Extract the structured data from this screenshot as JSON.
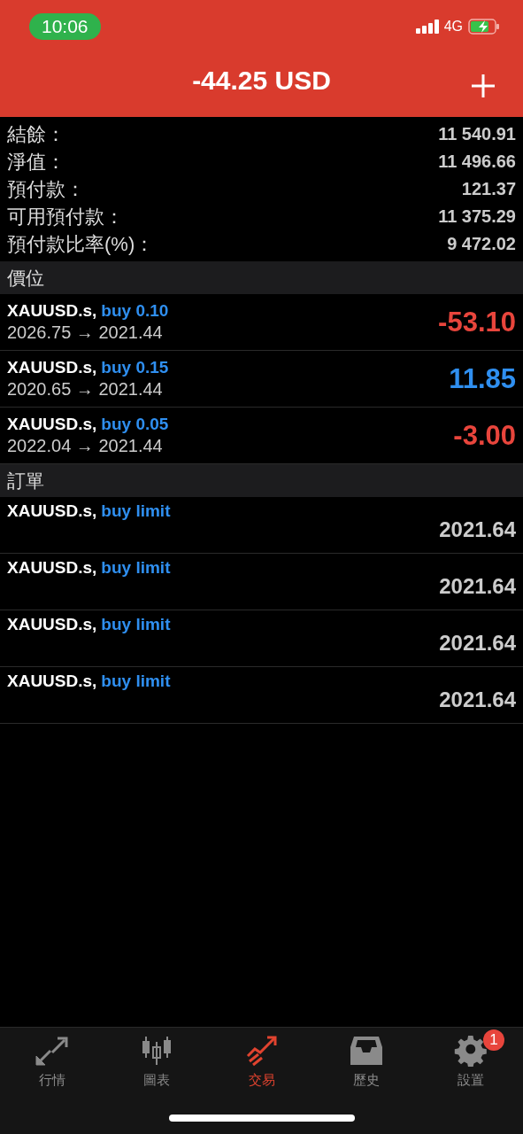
{
  "status_bar": {
    "time": "10:06",
    "network": "4G"
  },
  "header": {
    "title": "-44.25 USD"
  },
  "summary": [
    {
      "label": "結餘：",
      "value": "11 540.91"
    },
    {
      "label": "淨值：",
      "value": "11 496.66"
    },
    {
      "label": "預付款：",
      "value": "121.37"
    },
    {
      "label": "可用預付款：",
      "value": "11 375.29"
    },
    {
      "label": "預付款比率(%)：",
      "value": "9 472.02"
    }
  ],
  "positions": {
    "title": "價位",
    "items": [
      {
        "symbol": "XAUUSD.s,",
        "type": "buy 0.10",
        "prices": "2026.75 → 2021.44",
        "profit": "-53.10",
        "color": "#e8453c"
      },
      {
        "symbol": "XAUUSD.s,",
        "type": "buy 0.15",
        "prices": "2020.65 → 2021.44",
        "profit": "11.85",
        "color": "#2f8ff0"
      },
      {
        "symbol": "XAUUSD.s,",
        "type": "buy 0.05",
        "prices": "2022.04 → 2021.44",
        "profit": "-3.00",
        "color": "#e8453c"
      }
    ]
  },
  "orders": {
    "title": "訂單",
    "items": [
      {
        "symbol": "XAUUSD.s,",
        "type": "buy limit",
        "price": "2021.64"
      },
      {
        "symbol": "XAUUSD.s,",
        "type": "buy limit",
        "price": "2021.64"
      },
      {
        "symbol": "XAUUSD.s,",
        "type": "buy limit",
        "price": "2021.64"
      },
      {
        "symbol": "XAUUSD.s,",
        "type": "buy limit",
        "price": "2021.64"
      }
    ]
  },
  "tabs": [
    {
      "label": "行情",
      "selected": false,
      "kind": "quotes"
    },
    {
      "label": "圖表",
      "selected": false,
      "kind": "chart"
    },
    {
      "label": "交易",
      "selected": true,
      "kind": "trade"
    },
    {
      "label": "歷史",
      "selected": false,
      "kind": "history"
    },
    {
      "label": "設置",
      "selected": false,
      "kind": "settings",
      "badge": "1"
    }
  ]
}
